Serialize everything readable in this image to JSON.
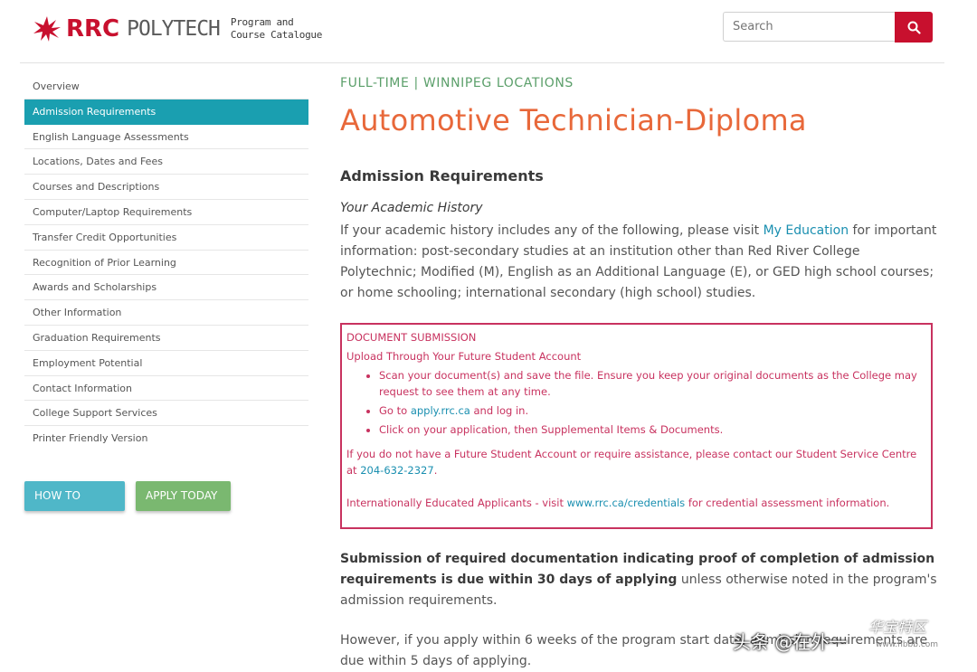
{
  "header": {
    "brand_rrc": "RRC",
    "brand_poly": "POLYTECH",
    "brand_sub_line1": "Program and",
    "brand_sub_line2": "Course Catalogue",
    "search_placeholder": "Search"
  },
  "sidebar": {
    "items": [
      {
        "label": "Overview"
      },
      {
        "label": "Admission Requirements"
      },
      {
        "label": "English Language Assessments"
      },
      {
        "label": "Locations, Dates and Fees"
      },
      {
        "label": "Courses and Descriptions"
      },
      {
        "label": "Computer/Laptop Requirements"
      },
      {
        "label": "Transfer Credit Opportunities"
      },
      {
        "label": "Recognition of Prior Learning"
      },
      {
        "label": "Awards and Scholarships"
      },
      {
        "label": "Other Information"
      },
      {
        "label": "Graduation Requirements"
      },
      {
        "label": "Employment Potential"
      },
      {
        "label": "Contact Information"
      },
      {
        "label": "College Support Services"
      },
      {
        "label": "Printer Friendly Version"
      }
    ],
    "active_index": 1,
    "how_to_apply": "HOW TO APPLY",
    "apply_today": "APPLY TODAY"
  },
  "main": {
    "kicker": "FULL-TIME | WINNIPEG LOCATIONS",
    "title": "Automotive Technician-Diploma",
    "section_heading": "Admission Requirements",
    "subheading": "Your Academic History",
    "para1_pre": "If your academic history includes any of the following, please visit ",
    "para1_link": "My Education",
    "para1_post": " for important information: post-secondary studies at an institution other than Red River College Polytechnic; Modified (M), English as an Additional Language (E), or GED high school courses; or home schooling; international secondary (high school) studies.",
    "box": {
      "title": "DOCUMENT SUBMISSION",
      "subtitle": "Upload Through Your Future Student Account",
      "bullet1": "Scan your document(s) and save the file. Ensure you keep your original documents as the College may request to see them at any time.",
      "bullet2_pre": "Go to ",
      "bullet2_link": "apply.rrc.ca",
      "bullet2_post": " and log in.",
      "bullet3": "Click on your application, then Supplemental Items & Documents.",
      "contact_pre": "If you do not have a Future Student Account or require assistance, please contact our Student Service Centre at ",
      "contact_link": "204-632-2327",
      "contact_post": ".",
      "intl_pre": "Internationally Educated Applicants",
      "intl_mid": " - visit ",
      "intl_link": "www.rrc.ca/credentials",
      "intl_post": " for credential assessment information."
    },
    "para2_bold": "Submission of required documentation indicating proof of completion of admission requirements is due within 30 days of applying",
    "para2_post": " unless otherwise noted in the program's admission requirements.",
    "para3": "However, if you apply within 6 weeks of the program start date, admission requirements are due within 5 days of applying."
  },
  "watermark": {
    "text": "头条 @在外一",
    "site_text": "华宝特区",
    "site_url": "www.hbbb.com"
  },
  "colors": {
    "brand_red": "#c8102e",
    "teal": "#1a9fb0",
    "green": "#7ab870",
    "orange": "#e8683a",
    "magenta": "#c8325f"
  }
}
